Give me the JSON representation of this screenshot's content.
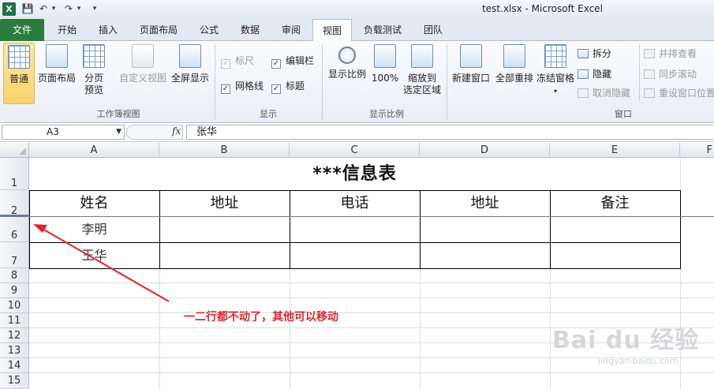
{
  "titlebar": {
    "app_icon": "X",
    "title": "test.xlsx  -  Microsoft Excel",
    "qat": {
      "save": "💾",
      "undo": "↶",
      "undo_more": "▾",
      "redo": "↷",
      "redo_more": "▾",
      "customize": "▾"
    }
  },
  "tabs": [
    "文件",
    "开始",
    "插入",
    "页面布局",
    "公式",
    "数据",
    "审阅",
    "视图",
    "负载测试",
    "团队"
  ],
  "ribbon": {
    "workbook_views": {
      "label": "工作簿视图",
      "normal": "普通",
      "page_layout": "页面布局",
      "page_break_1": "分页",
      "page_break_2": "预览",
      "custom_views": "自定义视图",
      "full_screen": "全屏显示"
    },
    "show": {
      "label": "显示",
      "ruler": "标尺",
      "formula_bar": "编辑栏",
      "gridlines": "网格线",
      "headings": "标题"
    },
    "zoom": {
      "label": "显示比例",
      "zoom": "显示比例",
      "hundred": "100%",
      "zoom_selection_1": "缩放到",
      "zoom_selection_2": "选定区域"
    },
    "window": {
      "label": "窗口",
      "new_window": "新建窗口",
      "arrange_all": "全部重排",
      "freeze_panes": "冻结窗格",
      "split": "拆分",
      "hide": "隐藏",
      "unhide": "取消隐藏",
      "side_by_side": "并排查看",
      "sync_scroll": "同步滚动",
      "reset_position": "重设窗口位置"
    }
  },
  "formula_bar": {
    "name_box": "A3",
    "fx": "fx",
    "value": "张华"
  },
  "sheet": {
    "columns": [
      "A",
      "B",
      "C",
      "D",
      "E",
      "F"
    ],
    "rows": [
      "1",
      "2",
      "6",
      "7",
      "8",
      "9",
      "10",
      "11",
      "12",
      "13",
      "14",
      "15"
    ],
    "title": "***信息表",
    "headers": [
      "姓名",
      "地址",
      "电话",
      "地址",
      "备注"
    ],
    "data": [
      [
        "李明",
        "",
        "",
        "",
        ""
      ],
      [
        "王华",
        "",
        "",
        "",
        ""
      ]
    ]
  },
  "annotation": "一二行都不动了，其他可以移动",
  "watermark": {
    "line1": "Bai du 经验",
    "line2": "jingyan.baidu.com"
  }
}
